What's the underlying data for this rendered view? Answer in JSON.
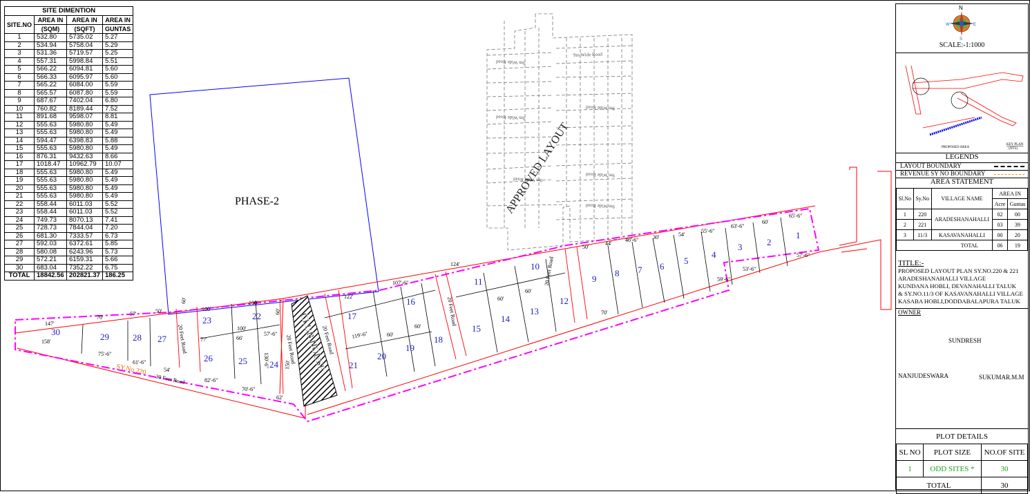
{
  "site_table": {
    "caption": "SITE DIMENTION",
    "headers": [
      "SITE.NO",
      "AREA IN (SQM)",
      "AREA IN (SQFT)",
      "AREA IN GUNTAS"
    ],
    "header_lines": [
      [
        "SITE.NO",
        ""
      ],
      [
        "AREA IN",
        "(SQM)"
      ],
      [
        "AREA IN",
        "(SQFT)"
      ],
      [
        "AREA IN",
        "GUNTAS"
      ]
    ],
    "rows": [
      [
        "1",
        "532.80",
        "5735.02",
        "5.27"
      ],
      [
        "2",
        "534.94",
        "5758.04",
        "5.29"
      ],
      [
        "3",
        "531.36",
        "5719.57",
        "5.25"
      ],
      [
        "4",
        "557.31",
        "5998.84",
        "5.51"
      ],
      [
        "5",
        "566.22",
        "6094.81",
        "5.60"
      ],
      [
        "6",
        "566.33",
        "6095.97",
        "5.60"
      ],
      [
        "7",
        "565.22",
        "6084.00",
        "5.59"
      ],
      [
        "8",
        "565.57",
        "6087.80",
        "5.59"
      ],
      [
        "9",
        "687.67",
        "7402.04",
        "6.80"
      ],
      [
        "10",
        "760.82",
        "8189.44",
        "7.52"
      ],
      [
        "11",
        "891.68",
        "9598.07",
        "8.81"
      ],
      [
        "12",
        "555.63",
        "5980.80",
        "5.49"
      ],
      [
        "13",
        "555.63",
        "5980.80",
        "5.49"
      ],
      [
        "14",
        "594.47",
        "6398.83",
        "5.88"
      ],
      [
        "15",
        "555.63",
        "5980.80",
        "5.49"
      ],
      [
        "16",
        "876.31",
        "9432.63",
        "8.66"
      ],
      [
        "17",
        "1018.47",
        "10962.79",
        "10.07"
      ],
      [
        "18",
        "555.63",
        "5980.80",
        "5.49"
      ],
      [
        "19",
        "555.63",
        "5980.80",
        "5.49"
      ],
      [
        "20",
        "555.63",
        "5980.80",
        "5.49"
      ],
      [
        "21",
        "555.63",
        "5980.80",
        "5.49"
      ],
      [
        "22",
        "558.44",
        "6011.03",
        "5.52"
      ],
      [
        "23",
        "558.44",
        "6011.03",
        "5.52"
      ],
      [
        "24",
        "749.73",
        "8070.13",
        "7.41"
      ],
      [
        "25",
        "728.73",
        "7844.04",
        "7.20"
      ],
      [
        "26",
        "681.30",
        "7333.57",
        "6.73"
      ],
      [
        "27",
        "592.03",
        "6372.61",
        "5.85"
      ],
      [
        "28",
        "580.08",
        "6243.96",
        "5.73"
      ],
      [
        "29",
        "572.21",
        "6159.31",
        "5.66"
      ],
      [
        "30",
        "683.04",
        "7352.22",
        "6.75"
      ]
    ],
    "total": [
      "TOTAL",
      "18842.56",
      "202821.37",
      "186.25"
    ]
  },
  "plan": {
    "phase_label": "PHASE-2",
    "approved_label": "APPROVED LAYOUT",
    "clubhouse_label": "CLUB HOUSE",
    "survey_label": "SY.No.220",
    "roads": [
      "30 Feet Road",
      "20 Feet Road",
      "20 Feet Road",
      "20 Feet Road",
      "20 Feet Road",
      "20 Feet Road"
    ],
    "approved_roads": [
      "9m Wide Road",
      "9m Wide Road",
      "9m Wide Road",
      "9m Wide Road",
      "9m Wide Road",
      "9m Wide Road",
      "9m Wide Road"
    ],
    "plot_numbers": [
      "1",
      "2",
      "3",
      "4",
      "5",
      "6",
      "7",
      "8",
      "9",
      "10",
      "11",
      "12",
      "13",
      "14",
      "15",
      "16",
      "17",
      "18",
      "19",
      "20",
      "21",
      "22",
      "23",
      "24",
      "25",
      "26",
      "27",
      "28",
      "29",
      "30"
    ],
    "dimensions": [
      "147'",
      "158'",
      "70'",
      "75'-6\"",
      "57'",
      "61'-6\"",
      "50'",
      "54'",
      "100'",
      "100'",
      "60'",
      "60'",
      "100'",
      "77'",
      "66'",
      "57'-6\"",
      "82'-6\"",
      "70'-6\"",
      "62'",
      "130'-6\"",
      "150'",
      "122'",
      "124'",
      "107'-6\"",
      "119'-6\"",
      "60'",
      "60'",
      "60'",
      "60'",
      "50'",
      "44'",
      "46'-6\"",
      "30'",
      "54'",
      "55'-6\"",
      "63'-6\"",
      "60'",
      "65'-6\"",
      "57'-6\"",
      "53'-6\"",
      "59'-6\"",
      "70'"
    ],
    "colors": {
      "boundary": "#ff00ff",
      "survey": "#ff0000",
      "phase": "#0000ff",
      "approved": "#777777",
      "plot_number": "#1f1fbf",
      "survey_text": "#e07000"
    }
  },
  "panel": {
    "compass_n": "N",
    "compass_w": "W",
    "compass_e": "E",
    "compass_s": "S",
    "scale": "SCALE:-1:1000",
    "keyplan_label": "KEY PLAN",
    "keyplan_sub": "(NTS)",
    "proposed_area": "PROPOSED AREA",
    "legends_title": "LEGENDS",
    "legend_items": [
      "LAYOUT BOUNDARY",
      "REVENUE SY NO BOUNDARY"
    ],
    "area_title": "AREA STATEMENT",
    "area_headers": [
      "Sl.No",
      "Sy.No",
      "VILLAGE NAME",
      "AREA IN",
      "Acre",
      "Guntas"
    ],
    "area_rows": [
      [
        "1",
        "220",
        "",
        "02",
        "00"
      ],
      [
        "2",
        "221",
        "ARADESHANAHALLI",
        "03",
        "39"
      ],
      [
        "3",
        "11/3",
        "KASAVANAHALLI",
        "00",
        "20"
      ]
    ],
    "area_total": [
      "TOTAL",
      "06",
      "19"
    ],
    "title_label": "TITLE:-",
    "title_lines": [
      "PROPOSED LAYOUT PLAN  SY.NO.220 & 221",
      "ARADESHANAHALLI VILLAGE",
      "KUNDANA HOBLI, DEVANAHALLI TALUK",
      "& SY.NO.11/3 OF KASAVANAHALLI VILLAGE",
      "KASABA HOBLI,DODDABALAPURA TALUK"
    ],
    "owner_label": "OWNER",
    "owners": [
      "SUNDRESH",
      "NANJUDESWARA",
      "SUKUMAR.M.M"
    ],
    "plot_title": "PLOT  DETAILS",
    "plot_headers": [
      "SL NO",
      "PLOT SIZE",
      "NO.OF SITE"
    ],
    "plot_rows": [
      [
        "1",
        "ODD SITES *",
        "30"
      ]
    ],
    "plot_total": [
      "TOTAL",
      "30"
    ],
    "colors": {
      "odd_sites": "#1aa51a"
    }
  }
}
